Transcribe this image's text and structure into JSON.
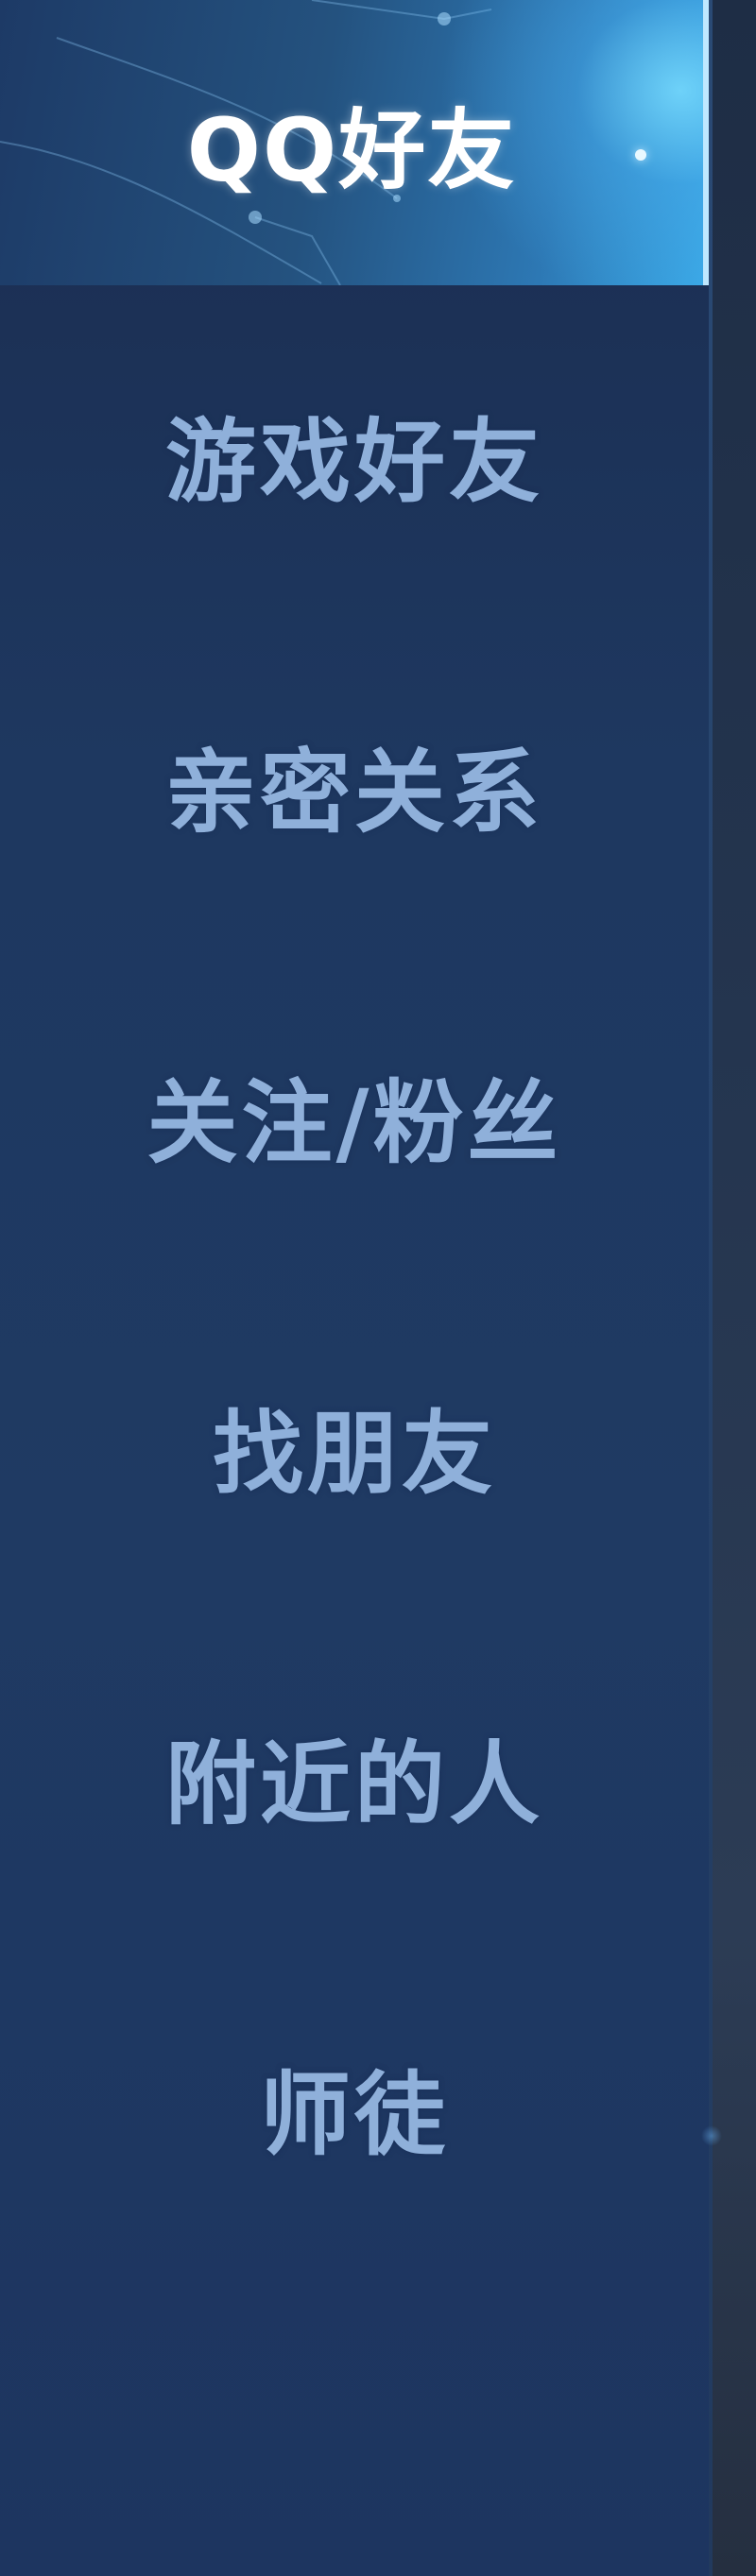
{
  "nav": {
    "items": [
      {
        "label": "QQ好友",
        "active": true
      },
      {
        "label": "游戏好友",
        "active": false
      },
      {
        "label": "亲密关系",
        "active": false
      },
      {
        "label": "关注/粉丝",
        "active": false
      },
      {
        "label": "找朋友",
        "active": false
      },
      {
        "label": "附近的人",
        "active": false
      },
      {
        "label": "师徒",
        "active": false
      }
    ]
  },
  "colors": {
    "background": "#1f3a63",
    "label": "#8fb0da",
    "active_label": "#ffffff",
    "active_highlight": "#3aa8e6"
  }
}
